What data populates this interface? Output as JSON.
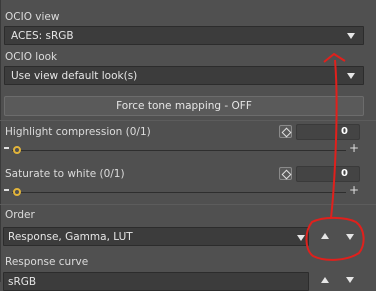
{
  "ocio_view": {
    "label": "OCIO view",
    "value": "ACES: sRGB"
  },
  "ocio_look": {
    "label": "OCIO look",
    "value": "Use view default look(s)"
  },
  "force_tone_mapping": {
    "label": "Force tone mapping - OFF"
  },
  "highlight_compression": {
    "label": "Highlight compression (0/1)",
    "value": "0"
  },
  "saturate_to_white": {
    "label": "Saturate to white (0/1)",
    "value": "0"
  },
  "order": {
    "label": "Order",
    "value": "Response, Gamma, LUT"
  },
  "response_curve": {
    "label": "Response curve",
    "value": "sRGB"
  },
  "colors": {
    "panel_bg": "#505050",
    "field_bg": "#3c3c3c",
    "knob": "#e2b43a",
    "annotation": "#e0201c"
  }
}
